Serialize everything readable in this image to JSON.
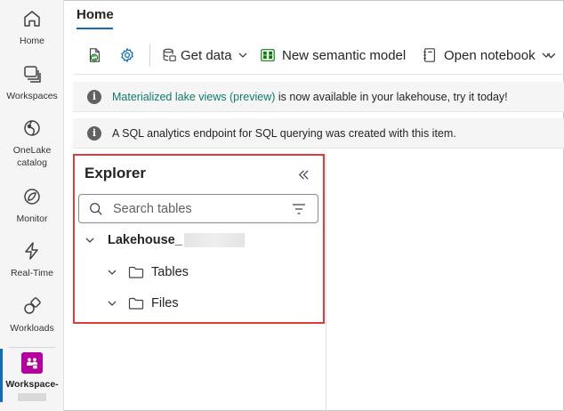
{
  "rail": {
    "items": [
      {
        "label": "Home",
        "icon": "home-icon"
      },
      {
        "label": "Workspaces",
        "icon": "workspaces-icon"
      },
      {
        "label_line1": "OneLake",
        "label_line2": "catalog",
        "icon": "onelake-catalog-icon"
      },
      {
        "label": "Monitor",
        "icon": "monitor-icon"
      },
      {
        "label": "Real-Time",
        "icon": "real-time-icon"
      },
      {
        "label": "Workloads",
        "icon": "workloads-icon"
      }
    ],
    "workspace": {
      "label": "Workspace-",
      "icon": "workspace-people-icon",
      "color": "#b4009e"
    }
  },
  "header": {
    "tab": "Home"
  },
  "toolbar": {
    "get_data": "Get data",
    "new_semantic_model": "New semantic model",
    "open_notebook": "Open notebook"
  },
  "banners": {
    "first_link": "Materialized lake views (preview)",
    "first_rest": " is now available in your lakehouse, try it today!",
    "second": "A SQL analytics endpoint for SQL querying was created with this item."
  },
  "explorer": {
    "title": "Explorer",
    "search_placeholder": "Search tables",
    "lakehouse_name": "Lakehouse_",
    "folders": [
      "Tables",
      "Files"
    ]
  },
  "colors": {
    "accent": "#0f6cbd",
    "highlight": "#e03c3c",
    "link": "#0f7b6c"
  }
}
